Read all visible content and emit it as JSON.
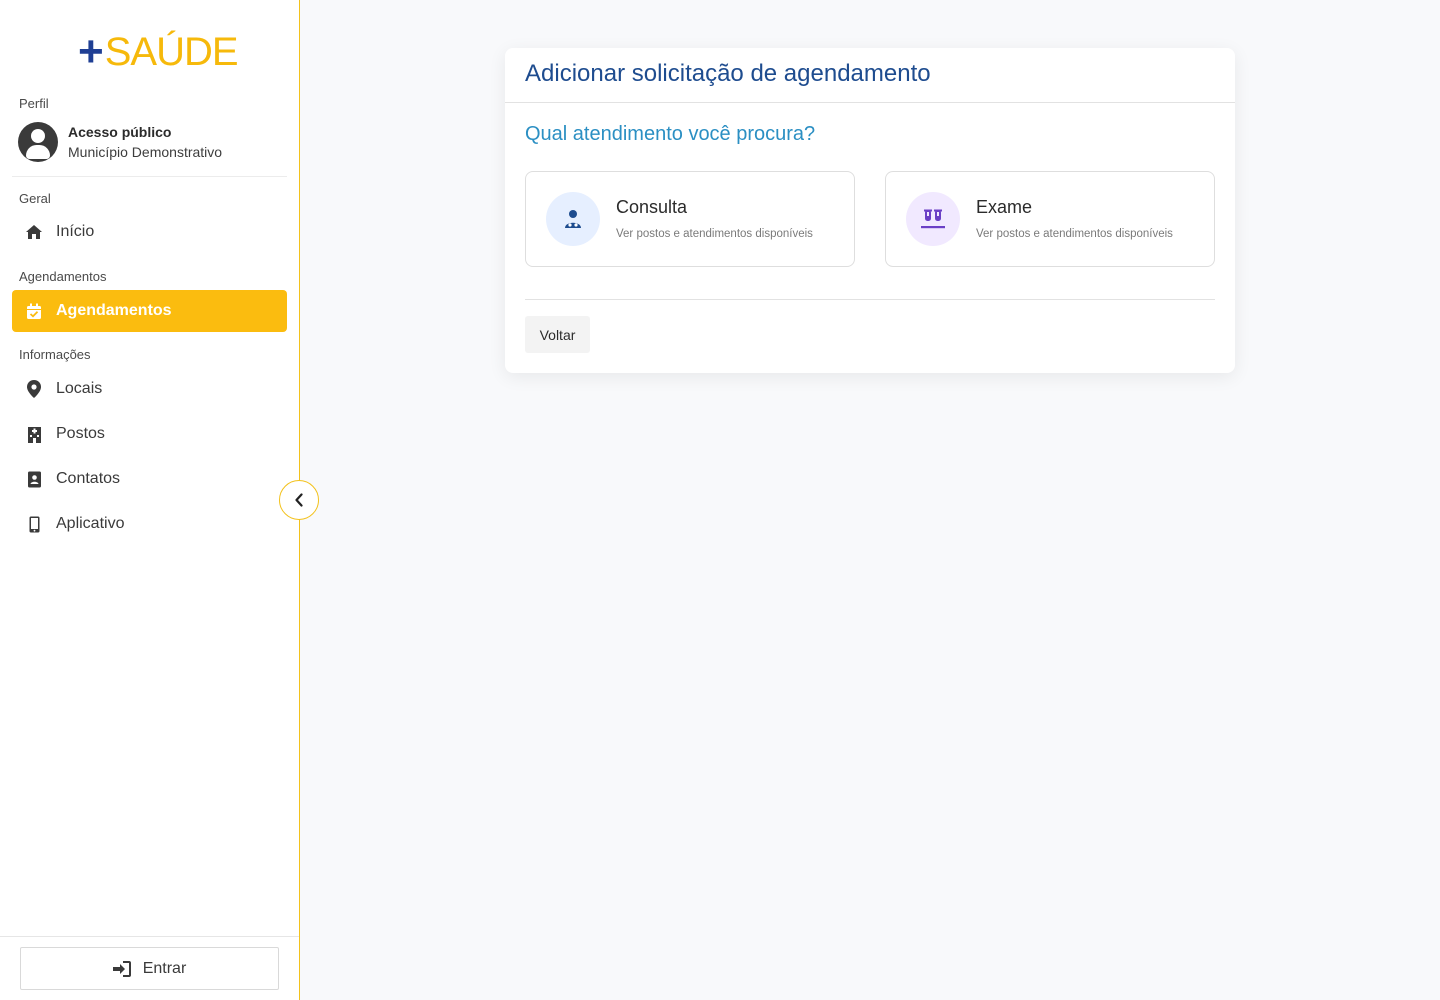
{
  "brand": {
    "plus": "+",
    "name": "SAÚDE"
  },
  "sidebar": {
    "profile_label": "Perfil",
    "profile": {
      "name": "Acesso público",
      "city": "Município Demonstrativo"
    },
    "sections": {
      "geral": "Geral",
      "agendamentos": "Agendamentos",
      "informacoes": "Informações"
    },
    "items": {
      "inicio": "Início",
      "agendamentos": "Agendamentos",
      "locais": "Locais",
      "postos": "Postos",
      "contatos": "Contatos",
      "aplicativo": "Aplicativo"
    },
    "login_label": "Entrar"
  },
  "main": {
    "title": "Adicionar solicitação de agendamento",
    "question": "Qual atendimento você procura?",
    "options": [
      {
        "title": "Consulta",
        "subtitle": "Ver postos e atendimentos disponíveis",
        "icon": "doctor-icon",
        "color": "#1e4c8f",
        "bg": "#e6efff"
      },
      {
        "title": "Exame",
        "subtitle": "Ver postos e atendimentos disponíveis",
        "icon": "test-tubes-icon",
        "color": "#6a3fc6",
        "bg": "#f1e9ff"
      }
    ],
    "back_label": "Voltar"
  },
  "colors": {
    "accent": "#fbbc0f",
    "brand_blue": "#1f3f94",
    "title_blue": "#1e4c8f",
    "question_blue": "#2b8fc3"
  }
}
